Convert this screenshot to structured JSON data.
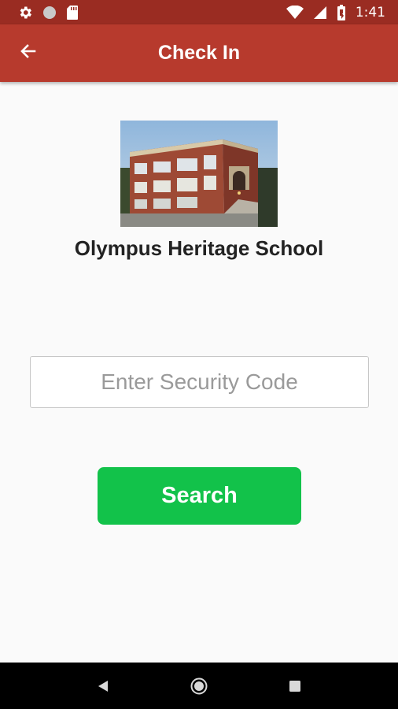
{
  "status_bar": {
    "time": "1:41",
    "icons": [
      "settings-icon",
      "circle-icon",
      "sd-card-icon",
      "wifi-icon",
      "signal-icon",
      "battery-icon"
    ]
  },
  "app_bar": {
    "title": "Check In",
    "back_icon": "arrow-left-icon",
    "color": "#b73a2d"
  },
  "school": {
    "name": "Olympus Heritage School"
  },
  "form": {
    "security_code_placeholder": "Enter Security Code",
    "security_code_value": "",
    "search_label": "Search",
    "search_color": "#12c24a"
  },
  "nav_bar": {
    "icons": [
      "back-triangle-icon",
      "home-circle-icon",
      "recents-square-icon"
    ]
  }
}
